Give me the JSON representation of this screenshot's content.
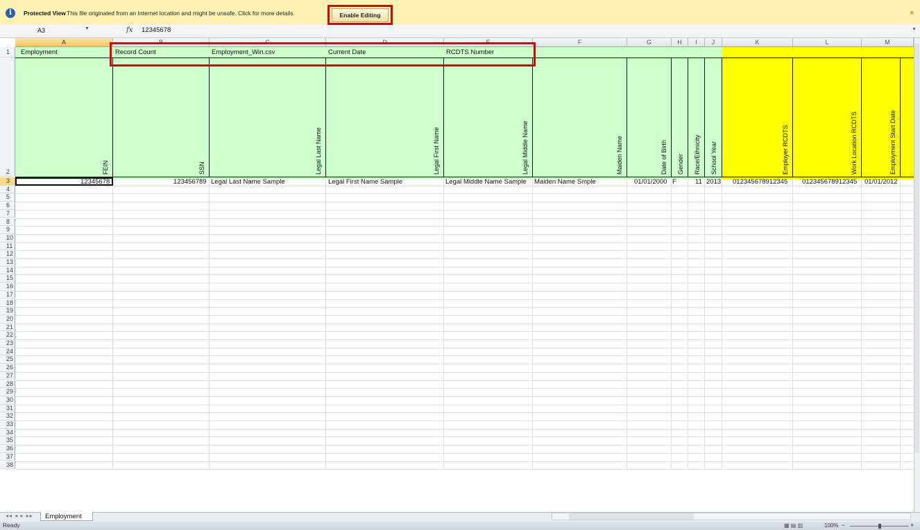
{
  "protected_view": {
    "title": "Protected View",
    "message": "This file originated from an Internet location and might be unsafe. Click for more details.",
    "button": "Enable Editing",
    "close": "×",
    "icon": "shield-info-icon"
  },
  "formula_bar": {
    "name_box": "A3",
    "fx": "fx",
    "value": "12345678"
  },
  "columns": [
    "A",
    "B",
    "C",
    "D",
    "E",
    "F",
    "G",
    "H",
    "I",
    "J",
    "K",
    "L",
    "M"
  ],
  "row_numbers": [
    "1",
    "2",
    "3",
    "4",
    "5",
    "6",
    "7",
    "8",
    "9",
    "10",
    "11",
    "12",
    "13",
    "14",
    "15",
    "16",
    "17",
    "18",
    "19",
    "20",
    "21",
    "22",
    "23",
    "24",
    "25",
    "26",
    "27",
    "28",
    "29",
    "30",
    "31",
    "32",
    "33",
    "34",
    "35",
    "36",
    "37",
    "38"
  ],
  "row1": {
    "a": "Employment",
    "b": "Record Count",
    "c": "Employment_Win.csv",
    "d": "Current Date",
    "e": "RCDTS Number"
  },
  "headers": {
    "a": "FEIN",
    "b": "SSN",
    "c": "Legal Last Name",
    "d": "Legal First Name",
    "e": "Legal Middle Name",
    "f": "Maiden Name",
    "g": "Date of Birth",
    "h": "Gender",
    "i": "Race/Ethnicity",
    "j": "School Year",
    "k": "Employer RCDTS",
    "l": "Work Location RCDTS",
    "m": "Employment Start Date"
  },
  "row3": {
    "a": "12345678",
    "b": "123456789",
    "c": "Legal Last Name Sample",
    "d": "Legal First Name Sample",
    "e": "Legal Middle Name Sample",
    "f": "Maiden  Name Smple",
    "g": "01/01/2000",
    "h": "F",
    "i": "11",
    "j": "2013",
    "k": "012345678912345",
    "l": "012345678912345",
    "m": "01/01/2012"
  },
  "colors": {
    "header_green": "#ccffcc",
    "header_yellow": "#ffff00",
    "highlight_red": "#e00000"
  },
  "sheet_tab": "Employment",
  "status": {
    "ready": "Ready",
    "zoom": "100%",
    "zoom_minus": "−",
    "zoom_plus": "+"
  }
}
